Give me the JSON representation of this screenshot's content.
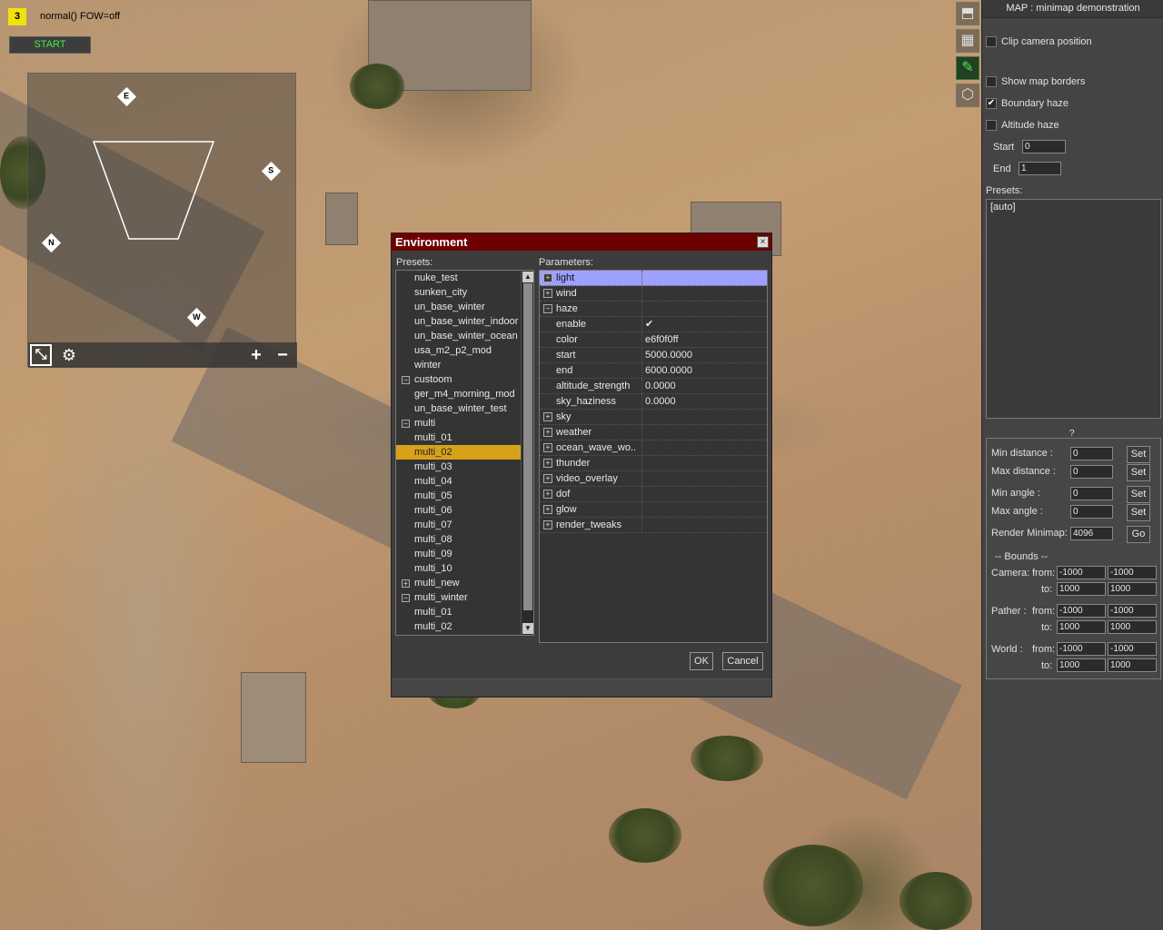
{
  "hud": {
    "player_number": "3",
    "mode_text": "normal() FOW=off",
    "start_label": "START"
  },
  "minimap": {
    "compass": {
      "e": "E",
      "s": "S",
      "n": "N",
      "w": "W"
    },
    "icons": [
      "resize-icon",
      "gear-icon",
      "zoom-in-icon",
      "zoom-out-icon"
    ],
    "zoom_in": "+",
    "zoom_out": "−"
  },
  "side_tools": [
    "map-object-icon",
    "grid-icon",
    "terrain-edit-icon",
    "cube-icon"
  ],
  "right_panel": {
    "title": "MAP : minimap demonstration",
    "clip_camera": {
      "label": "Clip camera position",
      "checked": false
    },
    "show_borders": {
      "label": "Show map borders",
      "checked": false
    },
    "boundary_haze": {
      "label": "Boundary haze",
      "checked": true
    },
    "altitude_haze": {
      "label": "Altitude haze",
      "checked": false
    },
    "start_label": "Start",
    "start_value": "0",
    "end_label": "End",
    "end_value": "1",
    "presets_label": "Presets:",
    "presets_items": [
      "[auto]"
    ],
    "question": "?",
    "min_distance_label": "Min distance :",
    "min_distance_value": "0",
    "max_distance_label": "Max distance :",
    "max_distance_value": "0",
    "min_angle_label": "Min angle :",
    "min_angle_value": "0",
    "max_angle_label": "Max angle :",
    "max_angle_value": "0",
    "set_label": "Set",
    "render_minimap_label": "Render Minimap:",
    "render_minimap_value": "4096",
    "go_label": "Go",
    "bounds_label": "-- Bounds --",
    "camera_label": "Camera:",
    "pather_label": "Pather  :",
    "world_label": "World   :",
    "from_label": "from:",
    "to_label": "to:",
    "camera_from": [
      "-1000",
      "-1000"
    ],
    "camera_to": [
      "1000",
      "1000"
    ],
    "pather_from": [
      "-1000",
      "-1000"
    ],
    "pather_to": [
      "1000",
      "1000"
    ],
    "world_from": [
      "-1000",
      "-1000"
    ],
    "world_to": [
      "1000",
      "1000"
    ]
  },
  "env_dialog": {
    "title": "Environment",
    "close": "×",
    "presets_label": "Presets:",
    "params_label": "Parameters:",
    "ok_label": "OK",
    "cancel_label": "Cancel",
    "tree": [
      {
        "label": "nuke_test",
        "indent": 1
      },
      {
        "label": "sunken_city",
        "indent": 1
      },
      {
        "label": "un_base_winter",
        "indent": 1
      },
      {
        "label": "un_base_winter_indoor",
        "indent": 1
      },
      {
        "label": "un_base_winter_ocean",
        "indent": 1
      },
      {
        "label": "usa_m2_p2_mod",
        "indent": 1
      },
      {
        "label": "winter",
        "indent": 1
      },
      {
        "label": "custoom",
        "indent": 0,
        "exp": "−"
      },
      {
        "label": "ger_m4_morning_mod",
        "indent": 1
      },
      {
        "label": "un_base_winter_test",
        "indent": 1
      },
      {
        "label": "multi",
        "indent": 0,
        "exp": "−"
      },
      {
        "label": "multi_01",
        "indent": 1
      },
      {
        "label": "multi_02",
        "indent": 1,
        "selected": true
      },
      {
        "label": "multi_03",
        "indent": 1
      },
      {
        "label": "multi_04",
        "indent": 1
      },
      {
        "label": "multi_05",
        "indent": 1
      },
      {
        "label": "multi_06",
        "indent": 1
      },
      {
        "label": "multi_07",
        "indent": 1
      },
      {
        "label": "multi_08",
        "indent": 1
      },
      {
        "label": "multi_09",
        "indent": 1
      },
      {
        "label": "multi_10",
        "indent": 1
      },
      {
        "label": "multi_new",
        "indent": 0,
        "exp": "+"
      },
      {
        "label": "multi_winter",
        "indent": 0,
        "exp": "−"
      },
      {
        "label": "multi_01",
        "indent": 1
      },
      {
        "label": "multi_02",
        "indent": 1
      }
    ],
    "params": [
      {
        "name": "light",
        "exp": "+",
        "selected": true,
        "value": ""
      },
      {
        "name": "wind",
        "exp": "+",
        "value": ""
      },
      {
        "name": "haze",
        "exp": "−",
        "value": ""
      },
      {
        "name": "enable",
        "child": true,
        "value": "✔"
      },
      {
        "name": "color",
        "child": true,
        "value": "e6f0f0ff"
      },
      {
        "name": "start",
        "child": true,
        "value": "5000.0000"
      },
      {
        "name": "end",
        "child": true,
        "value": "6000.0000"
      },
      {
        "name": "altitude_strength",
        "child": true,
        "value": "0.0000"
      },
      {
        "name": "sky_haziness",
        "child": true,
        "value": "0.0000"
      },
      {
        "name": "sky",
        "exp": "+",
        "value": ""
      },
      {
        "name": "weather",
        "exp": "+",
        "value": ""
      },
      {
        "name": "ocean_wave_wo..",
        "exp": "+",
        "value": ""
      },
      {
        "name": "thunder",
        "exp": "+",
        "value": ""
      },
      {
        "name": "video_overlay",
        "exp": "+",
        "value": ""
      },
      {
        "name": "dof",
        "exp": "+",
        "value": ""
      },
      {
        "name": "glow",
        "exp": "+",
        "value": ""
      },
      {
        "name": "render_tweaks",
        "exp": "+",
        "value": ""
      }
    ]
  }
}
